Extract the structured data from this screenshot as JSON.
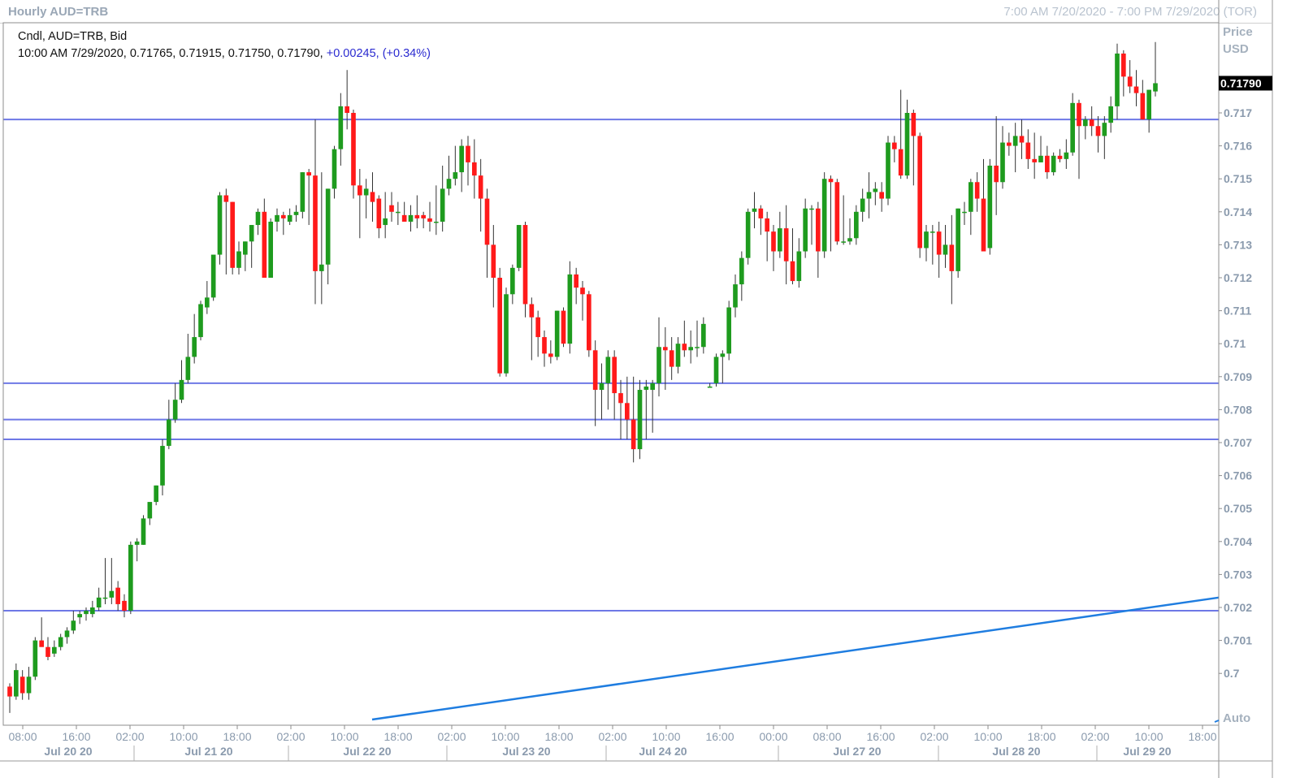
{
  "window": {
    "title": "Hourly AUD=TRB",
    "range": "7:00 AM 7/20/2020 - 7:00 PM 7/29/2020 (TOR)"
  },
  "legend": {
    "line1": "Cndl, AUD=TRB, Bid",
    "ohlc": "10:00 AM 7/29/2020, 0.71765, 0.71915, 0.71750, 0.71790,",
    "change": "+0.00245, (+0.34%)"
  },
  "price_axis": {
    "header_line1": "Price",
    "header_line2": "USD",
    "auto_label": "Auto",
    "current_price_label": "0.71790"
  },
  "colors": {
    "up": "#1e9b1e",
    "down": "#ff1a1a",
    "hline": "#6e78e6",
    "trendline": "#1f7de0",
    "grid_text": "#8a9aad"
  },
  "chart_data": {
    "type": "candlestick",
    "symbol": "AUD=TRB",
    "interval": "Hourly",
    "y_ticks": [
      "0.717",
      "0.716",
      "0.715",
      "0.714",
      "0.713",
      "0.712",
      "0.711",
      "0.71",
      "0.709",
      "0.708",
      "0.707",
      "0.706",
      "0.705",
      "0.704",
      "0.703",
      "0.702",
      "0.701",
      "0.7"
    ],
    "x_time_ticks": [
      "08:00",
      "16:00",
      "02:00",
      "10:00",
      "18:00",
      "02:00",
      "10:00",
      "18:00",
      "02:00",
      "10:00",
      "18:00",
      "02:00",
      "10:00",
      "16:00",
      "00:00",
      "08:00",
      "16:00",
      "02:00",
      "10:00",
      "18:00",
      "02:00",
      "10:00",
      "18:00"
    ],
    "x_date_ticks": [
      "Jul 20 20",
      "Jul 21 20",
      "Jul 22 20",
      "Jul 23 20",
      "Jul 24 20",
      "Jul 27 20",
      "Jul 28 20",
      "Jul 29 20"
    ],
    "last_close": 0.7179,
    "horizontal_levels": [
      0.7168,
      0.7088,
      0.7077,
      0.7071,
      0.7019
    ],
    "trendline": {
      "start_price": 0.6986,
      "end_price": 0.7023
    },
    "candles": [
      [
        0.6996,
        0.6997,
        0.6988,
        0.6993
      ],
      [
        0.6993,
        0.7003,
        0.6992,
        0.7001
      ],
      [
        0.6999,
        0.7001,
        0.6992,
        0.6994
      ],
      [
        0.6994,
        0.7002,
        0.6992,
        0.6999
      ],
      [
        0.6999,
        0.7011,
        0.6998,
        0.701
      ],
      [
        0.701,
        0.7017,
        0.7009,
        0.7008
      ],
      [
        0.7008,
        0.7011,
        0.7004,
        0.7005
      ],
      [
        0.7006,
        0.701,
        0.7005,
        0.7008
      ],
      [
        0.7008,
        0.7012,
        0.7007,
        0.7011
      ],
      [
        0.7011,
        0.7014,
        0.7009,
        0.7013
      ],
      [
        0.7013,
        0.7019,
        0.7012,
        0.7016
      ],
      [
        0.7017,
        0.7019,
        0.7015,
        0.7018
      ],
      [
        0.7018,
        0.702,
        0.7016,
        0.7019
      ],
      [
        0.7018,
        0.7022,
        0.7017,
        0.702
      ],
      [
        0.702,
        0.7026,
        0.7019,
        0.7023
      ],
      [
        0.7023,
        0.7035,
        0.7021,
        0.7023
      ],
      [
        0.7023,
        0.7035,
        0.7021,
        0.7025
      ],
      [
        0.7026,
        0.7028,
        0.7019,
        0.7021
      ],
      [
        0.7022,
        0.7024,
        0.7017,
        0.7019
      ],
      [
        0.7019,
        0.704,
        0.7018,
        0.7039
      ],
      [
        0.7039,
        0.7041,
        0.7034,
        0.704
      ],
      [
        0.7039,
        0.7048,
        0.7039,
        0.7047
      ],
      [
        0.7047,
        0.7051,
        0.7045,
        0.7052
      ],
      [
        0.7052,
        0.7057,
        0.7051,
        0.7057
      ],
      [
        0.7057,
        0.7071,
        0.7054,
        0.7069
      ],
      [
        0.7069,
        0.7083,
        0.7068,
        0.7077
      ],
      [
        0.7077,
        0.7088,
        0.7076,
        0.7083
      ],
      [
        0.7083,
        0.7095,
        0.7082,
        0.7089
      ],
      [
        0.7089,
        0.7103,
        0.7088,
        0.7096
      ],
      [
        0.7096,
        0.7109,
        0.7094,
        0.7102
      ],
      [
        0.7102,
        0.7113,
        0.7101,
        0.7112
      ],
      [
        0.7111,
        0.7119,
        0.7109,
        0.7114
      ],
      [
        0.7114,
        0.7125,
        0.7113,
        0.7127
      ],
      [
        0.7127,
        0.7146,
        0.7124,
        0.7145
      ],
      [
        0.7145,
        0.7147,
        0.7121,
        0.7143
      ],
      [
        0.7143,
        0.7143,
        0.7121,
        0.7123
      ],
      [
        0.7123,
        0.7131,
        0.7121,
        0.7128
      ],
      [
        0.7127,
        0.7131,
        0.7122,
        0.7131
      ],
      [
        0.7131,
        0.7136,
        0.7123,
        0.7136
      ],
      [
        0.7136,
        0.7141,
        0.7133,
        0.714
      ],
      [
        0.714,
        0.7144,
        0.7121,
        0.712
      ],
      [
        0.712,
        0.7138,
        0.7124,
        0.7137
      ],
      [
        0.7137,
        0.7141,
        0.7134,
        0.7139
      ],
      [
        0.7139,
        0.714,
        0.7133,
        0.7138
      ],
      [
        0.7137,
        0.7141,
        0.7136,
        0.7139
      ],
      [
        0.7139,
        0.7142,
        0.7137,
        0.714
      ],
      [
        0.714,
        0.7152,
        0.7138,
        0.7152
      ],
      [
        0.7152,
        0.7153,
        0.7136,
        0.7151
      ],
      [
        0.7151,
        0.7168,
        0.7112,
        0.7122
      ],
      [
        0.7122,
        0.7152,
        0.7112,
        0.7124
      ],
      [
        0.7124,
        0.7147,
        0.7118,
        0.7147
      ],
      [
        0.7147,
        0.716,
        0.7144,
        0.7159
      ],
      [
        0.7159,
        0.7176,
        0.7154,
        0.7172
      ],
      [
        0.7172,
        0.7183,
        0.7165,
        0.717
      ],
      [
        0.717,
        0.7171,
        0.7144,
        0.7148
      ],
      [
        0.7148,
        0.7153,
        0.7132,
        0.7145
      ],
      [
        0.7145,
        0.715,
        0.7138,
        0.7147
      ],
      [
        0.7146,
        0.7152,
        0.7137,
        0.7143
      ],
      [
        0.7144,
        0.7145,
        0.7132,
        0.7135
      ],
      [
        0.7136,
        0.7146,
        0.7132,
        0.7138
      ],
      [
        0.7142,
        0.7146,
        0.7137,
        0.714
      ],
      [
        0.714,
        0.7143,
        0.7136,
        0.714
      ],
      [
        0.7139,
        0.7143,
        0.7137,
        0.7137
      ],
      [
        0.7137,
        0.7142,
        0.7134,
        0.7139
      ],
      [
        0.7139,
        0.7145,
        0.7135,
        0.7138
      ],
      [
        0.7139,
        0.714,
        0.7135,
        0.7138
      ],
      [
        0.7138,
        0.7143,
        0.7134,
        0.7137
      ],
      [
        0.7137,
        0.7148,
        0.7133,
        0.7137
      ],
      [
        0.7137,
        0.7154,
        0.7134,
        0.7147
      ],
      [
        0.7147,
        0.7157,
        0.7145,
        0.715
      ],
      [
        0.715,
        0.716,
        0.7148,
        0.7152
      ],
      [
        0.7152,
        0.7162,
        0.7146,
        0.716
      ],
      [
        0.716,
        0.7163,
        0.7148,
        0.7155
      ],
      [
        0.7155,
        0.7162,
        0.7144,
        0.7151
      ],
      [
        0.7151,
        0.7156,
        0.7134,
        0.7144
      ],
      [
        0.7144,
        0.7147,
        0.712,
        0.713
      ],
      [
        0.713,
        0.7136,
        0.7111,
        0.712
      ],
      [
        0.712,
        0.7123,
        0.709,
        0.7091
      ],
      [
        0.7091,
        0.7117,
        0.709,
        0.7115
      ],
      [
        0.7115,
        0.7124,
        0.7112,
        0.7123
      ],
      [
        0.7123,
        0.7136,
        0.7122,
        0.7136
      ],
      [
        0.7136,
        0.7137,
        0.7108,
        0.7112
      ],
      [
        0.7112,
        0.7114,
        0.7095,
        0.7108
      ],
      [
        0.7108,
        0.711,
        0.7096,
        0.7102
      ],
      [
        0.7102,
        0.7104,
        0.7093,
        0.7097
      ],
      [
        0.7097,
        0.7101,
        0.7094,
        0.7096
      ],
      [
        0.7096,
        0.711,
        0.7095,
        0.711
      ],
      [
        0.711,
        0.7111,
        0.7099,
        0.71
      ],
      [
        0.71,
        0.7125,
        0.7097,
        0.7121
      ],
      [
        0.7121,
        0.7123,
        0.7112,
        0.7117
      ],
      [
        0.7117,
        0.7119,
        0.7107,
        0.7115
      ],
      [
        0.7115,
        0.7116,
        0.7096,
        0.7098
      ],
      [
        0.7098,
        0.7101,
        0.7075,
        0.7086
      ],
      [
        0.7086,
        0.7094,
        0.7077,
        0.7088
      ],
      [
        0.7088,
        0.7098,
        0.708,
        0.7096
      ],
      [
        0.7096,
        0.7098,
        0.7077,
        0.7085
      ],
      [
        0.7085,
        0.7089,
        0.7071,
        0.7082
      ],
      [
        0.7082,
        0.709,
        0.7071,
        0.7077
      ],
      [
        0.7077,
        0.709,
        0.7064,
        0.7068
      ],
      [
        0.7068,
        0.7089,
        0.7065,
        0.7086
      ],
      [
        0.7086,
        0.7089,
        0.7071,
        0.7087
      ],
      [
        0.7086,
        0.7089,
        0.7073,
        0.7088
      ],
      [
        0.7088,
        0.7108,
        0.7084,
        0.7099
      ],
      [
        0.7099,
        0.7105,
        0.7086,
        0.7098
      ],
      [
        0.7098,
        0.7102,
        0.7089,
        0.7093
      ],
      [
        0.7093,
        0.7102,
        0.7091,
        0.71
      ],
      [
        0.71,
        0.7107,
        0.7096,
        0.7098
      ],
      [
        0.7098,
        0.7104,
        0.7094,
        0.7099
      ],
      [
        0.7099,
        0.7107,
        0.7096,
        0.7099
      ],
      [
        0.7099,
        0.7108,
        0.7097,
        0.7106
      ],
      [
        0.7087,
        0.7088,
        0.7087,
        0.7087
      ],
      [
        0.7088,
        0.7097,
        0.7087,
        0.7096
      ],
      [
        0.7096,
        0.7098,
        0.7088,
        0.7097
      ],
      [
        0.7097,
        0.7113,
        0.7095,
        0.7111
      ],
      [
        0.7111,
        0.7121,
        0.7108,
        0.7118
      ],
      [
        0.7118,
        0.7128,
        0.7113,
        0.7126
      ],
      [
        0.7126,
        0.7141,
        0.7124,
        0.714
      ],
      [
        0.714,
        0.7146,
        0.7135,
        0.7141
      ],
      [
        0.7141,
        0.7142,
        0.7133,
        0.7138
      ],
      [
        0.7138,
        0.714,
        0.7125,
        0.7134
      ],
      [
        0.7134,
        0.7136,
        0.7122,
        0.7128
      ],
      [
        0.7128,
        0.714,
        0.7126,
        0.7135
      ],
      [
        0.7135,
        0.7142,
        0.7118,
        0.7125
      ],
      [
        0.7125,
        0.7135,
        0.7118,
        0.7119
      ],
      [
        0.7119,
        0.7132,
        0.7117,
        0.7128
      ],
      [
        0.7128,
        0.7144,
        0.7126,
        0.7141
      ],
      [
        0.7141,
        0.7142,
        0.713,
        0.7141
      ],
      [
        0.7141,
        0.7143,
        0.712,
        0.7128
      ],
      [
        0.7128,
        0.7152,
        0.7126,
        0.715
      ],
      [
        0.715,
        0.7151,
        0.7128,
        0.7149
      ],
      [
        0.7149,
        0.715,
        0.713,
        0.7131
      ],
      [
        0.7131,
        0.7145,
        0.713,
        0.7131
      ],
      [
        0.7131,
        0.7138,
        0.713,
        0.7132
      ],
      [
        0.7132,
        0.7142,
        0.713,
        0.714
      ],
      [
        0.714,
        0.7147,
        0.7137,
        0.7144
      ],
      [
        0.7144,
        0.7152,
        0.7138,
        0.7146
      ],
      [
        0.7146,
        0.7149,
        0.7142,
        0.7147
      ],
      [
        0.7146,
        0.7149,
        0.714,
        0.7144
      ],
      [
        0.7144,
        0.7163,
        0.7142,
        0.7161
      ],
      [
        0.7161,
        0.7163,
        0.7155,
        0.7159
      ],
      [
        0.7159,
        0.7177,
        0.715,
        0.7151
      ],
      [
        0.7151,
        0.7174,
        0.715,
        0.717
      ],
      [
        0.717,
        0.7171,
        0.7148,
        0.7163
      ],
      [
        0.7163,
        0.7164,
        0.7126,
        0.7129
      ],
      [
        0.7129,
        0.7136,
        0.7125,
        0.7134
      ],
      [
        0.7134,
        0.7136,
        0.7124,
        0.7134
      ],
      [
        0.7134,
        0.7137,
        0.712,
        0.7127
      ],
      [
        0.7127,
        0.7136,
        0.7123,
        0.713
      ],
      [
        0.713,
        0.7139,
        0.7112,
        0.7122
      ],
      [
        0.7122,
        0.7141,
        0.712,
        0.7141
      ],
      [
        0.714,
        0.7143,
        0.7136,
        0.714
      ],
      [
        0.714,
        0.715,
        0.7133,
        0.7149
      ],
      [
        0.7149,
        0.7152,
        0.714,
        0.7144
      ],
      [
        0.7144,
        0.7156,
        0.7139,
        0.7128
      ],
      [
        0.7129,
        0.7156,
        0.7127,
        0.7154
      ],
      [
        0.7154,
        0.7169,
        0.7139,
        0.7149
      ],
      [
        0.7149,
        0.7166,
        0.7147,
        0.7161
      ],
      [
        0.7161,
        0.7164,
        0.7157,
        0.716
      ],
      [
        0.716,
        0.7167,
        0.7152,
        0.7163
      ],
      [
        0.7163,
        0.7168,
        0.7156,
        0.7161
      ],
      [
        0.7161,
        0.7165,
        0.7153,
        0.7156
      ],
      [
        0.7156,
        0.7164,
        0.715,
        0.7155
      ],
      [
        0.7155,
        0.7163,
        0.7155,
        0.7157
      ],
      [
        0.7157,
        0.716,
        0.715,
        0.7152
      ],
      [
        0.7152,
        0.7158,
        0.7151,
        0.7157
      ],
      [
        0.7157,
        0.7159,
        0.7155,
        0.7156
      ],
      [
        0.7156,
        0.7162,
        0.7153,
        0.7158
      ],
      [
        0.7158,
        0.7176,
        0.7157,
        0.7173
      ],
      [
        0.7173,
        0.7174,
        0.715,
        0.7166
      ],
      [
        0.7166,
        0.7169,
        0.7162,
        0.7168
      ],
      [
        0.7168,
        0.7172,
        0.7163,
        0.7166
      ],
      [
        0.7166,
        0.7169,
        0.7158,
        0.7163
      ],
      [
        0.7163,
        0.7169,
        0.7156,
        0.7167
      ],
      [
        0.7167,
        0.7175,
        0.7164,
        0.7172
      ],
      [
        0.7172,
        0.7191,
        0.7168,
        0.7188
      ],
      [
        0.7188,
        0.7189,
        0.7175,
        0.7181
      ],
      [
        0.7181,
        0.7186,
        0.7176,
        0.7178
      ],
      [
        0.7178,
        0.7183,
        0.7172,
        0.7176
      ],
      [
        0.7176,
        0.718,
        0.7168,
        0.7168
      ],
      [
        0.7168,
        0.7177,
        0.7164,
        0.7177
      ],
      [
        0.71765,
        0.71915,
        0.7175,
        0.7179
      ]
    ]
  }
}
